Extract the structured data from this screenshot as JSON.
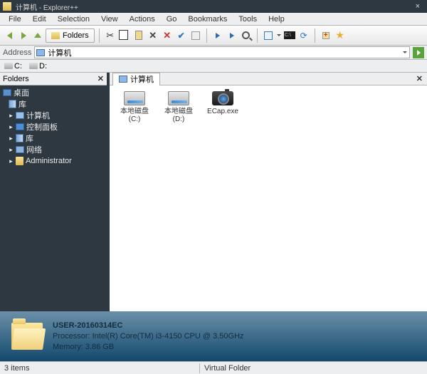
{
  "title": "计算机 - Explorer++",
  "menus": [
    "File",
    "Edit",
    "Selection",
    "View",
    "Actions",
    "Go",
    "Bookmarks",
    "Tools",
    "Help"
  ],
  "folders_btn": "Folders",
  "address_label": "Address",
  "address_value": "计算机",
  "drives": [
    "C:",
    "D:"
  ],
  "tree_panel_title": "Folders",
  "tree": {
    "root": "桌面",
    "lib_root": "库",
    "items": [
      "计算机",
      "控制面板",
      "库",
      "网络",
      "Administrator"
    ]
  },
  "tab_label": "计算机",
  "files": [
    {
      "label": "本地磁盘 (C:)",
      "type": "hdd"
    },
    {
      "label": "本地磁盘 (D:)",
      "type": "hdd"
    },
    {
      "label": "ECap.exe",
      "type": "camera"
    }
  ],
  "sysinfo": {
    "hostname": "USER-20160314EC",
    "cpu": "Processor: Intel(R) Core(TM) i3-4150 CPU @ 3.50GHz",
    "mem": "Memory: 3.86 GB"
  },
  "status": {
    "items": "3 items",
    "type": "Virtual Folder"
  }
}
